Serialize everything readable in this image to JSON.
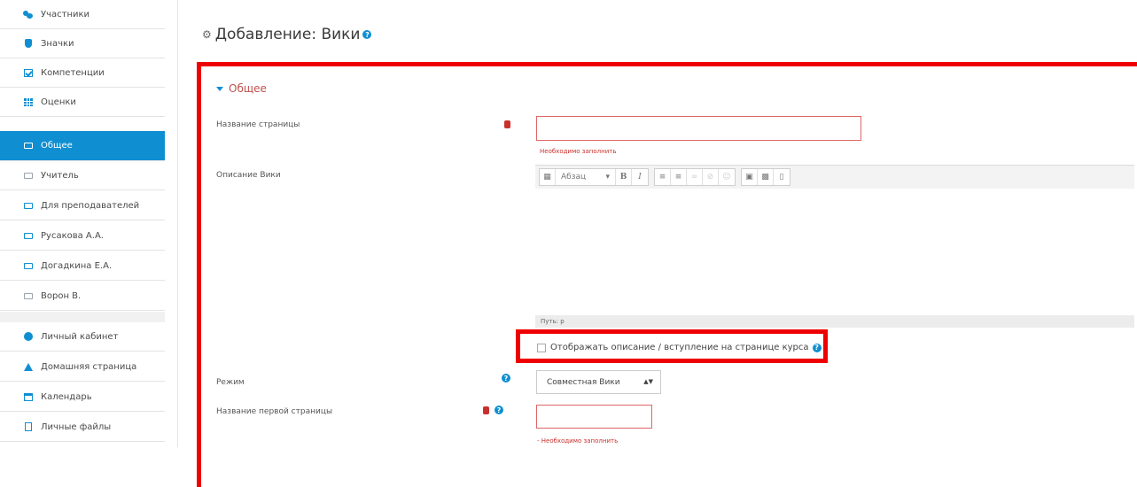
{
  "nav": {
    "items": [
      {
        "label": "Участники",
        "icon": "users-icon"
      },
      {
        "label": "Значки",
        "icon": "shield-icon"
      },
      {
        "label": "Компетенции",
        "icon": "checkbox-icon"
      },
      {
        "label": "Оценки",
        "icon": "table-icon"
      },
      {
        "label": "Общее",
        "icon": "folder-icon",
        "active": true
      },
      {
        "label": "Учитель",
        "icon": "folder-icon"
      },
      {
        "label": "Для преподавателей",
        "icon": "folder-icon"
      },
      {
        "label": "Русакова А.А.",
        "icon": "folder-icon"
      },
      {
        "label": "Догадкина Е.А.",
        "icon": "folder-icon"
      },
      {
        "label": "Ворон В.",
        "icon": "folder-icon"
      },
      {
        "label": "Личный кабинет",
        "icon": "dashboard-icon"
      },
      {
        "label": "Домашняя страница",
        "icon": "home-icon"
      },
      {
        "label": "Календарь",
        "icon": "calendar-icon"
      },
      {
        "label": "Личные файлы",
        "icon": "file-icon"
      }
    ]
  },
  "header": {
    "title": "Добавление: Вики",
    "help": "?"
  },
  "form": {
    "section_title": "Общее",
    "page_name_label": "Название страницы",
    "required_error": "Необходимо заполнить",
    "description_label": "Описание Вики",
    "editor": {
      "paragraph_label": "Абзац",
      "bold": "B",
      "italic": "I",
      "path": "Путь: p"
    },
    "show_description_label": "Отображать описание / вступление на странице курса",
    "mode_label": "Режим",
    "mode_value": "Совместная Вики",
    "first_page_label": "Название первой страницы",
    "first_page_error": "- Необходимо заполнить"
  },
  "colors": {
    "accent": "#0f8fd1",
    "highlight_red": "#e00000",
    "error_red": "#c9302c"
  }
}
